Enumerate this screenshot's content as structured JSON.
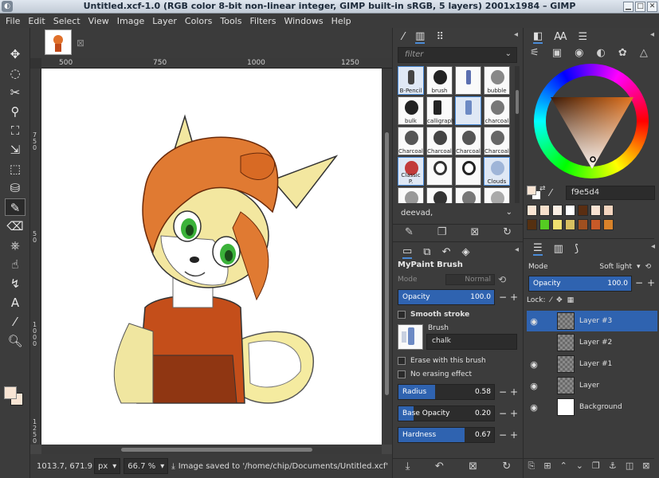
{
  "window": {
    "title": "Untitled.xcf-1.0 (RGB color 8-bit non-linear integer, GIMP built-in sRGB, 5 layers) 2001x1984 – GIMP",
    "minimize": "▁",
    "maximize": "□",
    "close": "✕"
  },
  "menu": [
    "File",
    "Edit",
    "Select",
    "View",
    "Image",
    "Layer",
    "Colors",
    "Tools",
    "Filters",
    "Windows",
    "Help"
  ],
  "rulers": {
    "h_ticks": [
      "500",
      "750",
      "1000",
      "1250"
    ],
    "v_ticks": [
      "5 0",
      "7 5 0",
      "1 0 0 0",
      "1 2 5 0"
    ]
  },
  "status": {
    "coords": "1013.7, 671.9",
    "unit": "px",
    "zoom": "66.7 %",
    "message": "Image saved to '/home/chip/Documents/Untitled.xcf'"
  },
  "brushes": {
    "filter_placeholder": "filter",
    "tag": "deevad,",
    "grid": [
      [
        "B-Pencil",
        "brush",
        "",
        "bubble"
      ],
      [
        "bulk",
        "calligraphy",
        "",
        "charcoal"
      ],
      [
        "Charcoal",
        "Charcoal",
        "Charcoal",
        "Charcoal"
      ],
      [
        "Classic P.",
        "",
        "",
        "Clouds"
      ],
      [
        "",
        "",
        "",
        ""
      ]
    ]
  },
  "tool_options": {
    "title": "MyPaint Brush",
    "mode_label": "Mode",
    "mode_value": "Normal",
    "opacity": {
      "label": "Opacity",
      "value": "100.0",
      "level": 1.0
    },
    "smooth_stroke": "Smooth stroke",
    "brush_label": "Brush",
    "brush_name": "chalk",
    "erase": "Erase with this brush",
    "no_erasing": "No erasing effect",
    "radius": {
      "label": "Radius",
      "value": "0.58",
      "level": 0.38
    },
    "base_opacity": {
      "label": "Base Opacity",
      "value": "0.20",
      "level": 0.16
    },
    "hardness": {
      "label": "Hardness",
      "value": "0.67",
      "level": 0.69
    }
  },
  "colors": {
    "fg": "#f9e5d4",
    "hex": "f9e5d4",
    "history_row1": [
      "#f9e5d4",
      "#f6dfcb",
      "#fbefe4",
      "#ffffff",
      "#5a2e12",
      "#f8e2d2",
      "#f3d5bf"
    ],
    "history_row2": [
      "#553010",
      "#55cc22",
      "#f0e070",
      "#d8c060",
      "#a05020",
      "#c85a28",
      "#d8822a"
    ]
  },
  "layers": {
    "mode_label": "Mode",
    "mode_value": "Soft light",
    "opacity_label": "Opacity",
    "opacity_value": "100.0",
    "lock_label": "Lock:",
    "items": [
      "Layer #3",
      "Layer #2",
      "Layer #1",
      "Layer",
      "Background"
    ]
  }
}
